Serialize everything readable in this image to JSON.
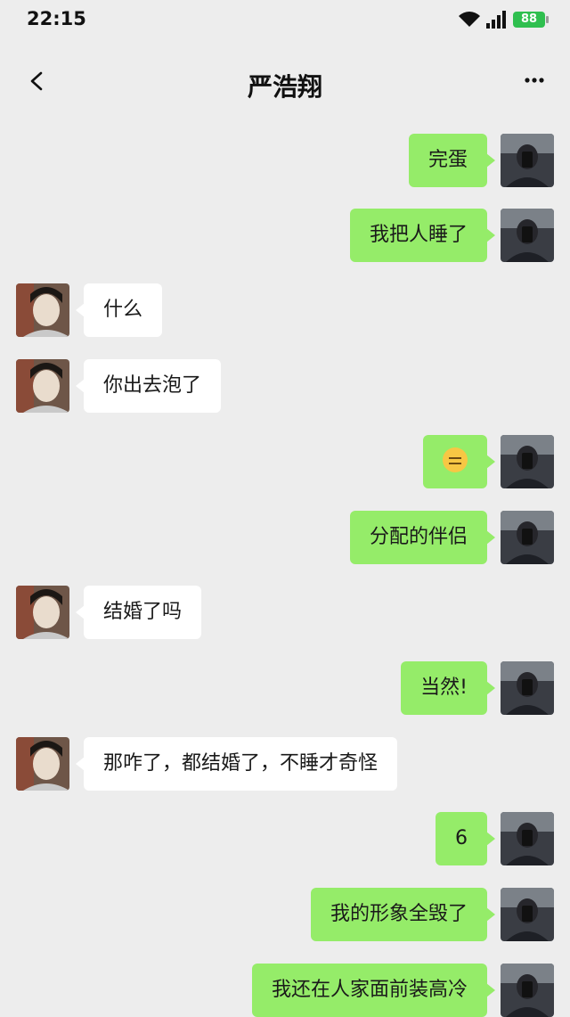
{
  "status_bar": {
    "time": "22:15",
    "battery": "88"
  },
  "header": {
    "title": "严浩翔"
  },
  "colors": {
    "sent_bubble": "#95ec69",
    "received_bubble": "#ffffff",
    "background": "#ededed"
  },
  "messages": [
    {
      "side": "right",
      "text": "完蛋"
    },
    {
      "side": "right",
      "text": "我把人睡了"
    },
    {
      "side": "left",
      "text": "什么"
    },
    {
      "side": "left",
      "text": "你出去泡了"
    },
    {
      "side": "right",
      "text": "",
      "emoji": "expressionless-face-emoji"
    },
    {
      "side": "right",
      "text": "分配的伴侣"
    },
    {
      "side": "left",
      "text": "结婚了吗"
    },
    {
      "side": "right",
      "text": "当然!"
    },
    {
      "side": "left",
      "text": "那咋了，都结婚了，不睡才奇怪"
    },
    {
      "side": "right",
      "text": "6"
    },
    {
      "side": "right",
      "text": "我的形象全毁了"
    },
    {
      "side": "right",
      "text": "我还在人家面前装高冷"
    }
  ]
}
